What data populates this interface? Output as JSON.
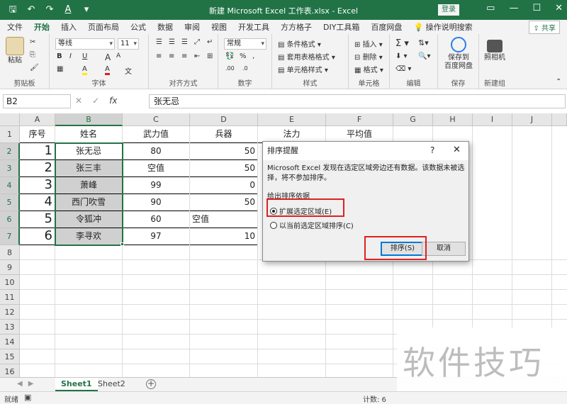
{
  "titlebar": {
    "title": "新建 Microsoft Excel 工作表.xlsx  -  Excel",
    "login": "登录",
    "qat_icons": [
      "save-icon",
      "undo-icon",
      "redo-icon",
      "font-color-icon",
      "customize-icon"
    ]
  },
  "tabs": [
    "文件",
    "开始",
    "插入",
    "页面布局",
    "公式",
    "数据",
    "审阅",
    "视图",
    "开发工具",
    "方方格子",
    "DIY工具箱",
    "百度网盘",
    "操作说明搜索"
  ],
  "share": "共享",
  "ribbon": {
    "clipboard": {
      "paste": "粘贴",
      "label": "剪贴板"
    },
    "font": {
      "name": "等线",
      "size": "11",
      "bold": "B",
      "italic": "I",
      "underline": "U",
      "grow": "A",
      "shrink": "A",
      "font_color": "A",
      "fill_color": "A",
      "label": "字体"
    },
    "alignment": {
      "label": "对齐方式"
    },
    "number": {
      "format": "常规",
      "label": "数字"
    },
    "styles": {
      "conditional": "条件格式",
      "table": "套用表格格式",
      "cell": "单元格样式",
      "label": "样式"
    },
    "cells": {
      "insert": "插入",
      "delete": "删除",
      "format": "格式",
      "label": "单元格"
    },
    "editing": {
      "label": "编辑"
    },
    "save": {
      "btn": "保存到\n百度网盘",
      "label": "保存"
    },
    "new": {
      "btn": "照相机",
      "label": "新建组"
    }
  },
  "formula_bar": {
    "name_box": "B2",
    "cancel": "✕",
    "enter": "✓",
    "fx": "fx",
    "content": "张无忌"
  },
  "columns": [
    "A",
    "B",
    "C",
    "D",
    "E",
    "F",
    "G",
    "H",
    "I",
    "J"
  ],
  "rows": [
    "1",
    "2",
    "3",
    "4",
    "5",
    "6",
    "7",
    "8",
    "9",
    "10",
    "11",
    "12",
    "13",
    "14",
    "15",
    "16"
  ],
  "table": {
    "headers": [
      "序号",
      "姓名",
      "武力值",
      "兵器",
      "法力",
      "平均值"
    ],
    "rows": [
      [
        "1",
        "张无忌",
        "80",
        "50"
      ],
      [
        "2",
        "张三丰",
        "空值",
        "50"
      ],
      [
        "3",
        "萧峰",
        "99",
        "0"
      ],
      [
        "4",
        "西门吹雪",
        "90",
        "50"
      ],
      [
        "5",
        "令狐冲",
        "60",
        "空值"
      ],
      [
        "6",
        "李寻欢",
        "97",
        "10"
      ]
    ]
  },
  "sheets": [
    "Sheet1",
    "Sheet2"
  ],
  "status": {
    "ready": "就绪",
    "count": "计数: 6"
  },
  "dialog": {
    "title": "排序提醒",
    "help": "?",
    "close": "✕",
    "message": "Microsoft Excel 发现在选定区域旁边还有数据。该数据未被选择，将不参加排序。",
    "section": "给出排序依据",
    "option_expand": "扩展选定区域(E)",
    "option_current": "以当前选定区域排序(C)",
    "sort_btn": "排序(S)",
    "cancel_btn": "取消"
  },
  "watermark": "软件技巧",
  "colors": {
    "accent": "#217346",
    "highlight": "#e02020",
    "default_button": "#0078d7"
  }
}
